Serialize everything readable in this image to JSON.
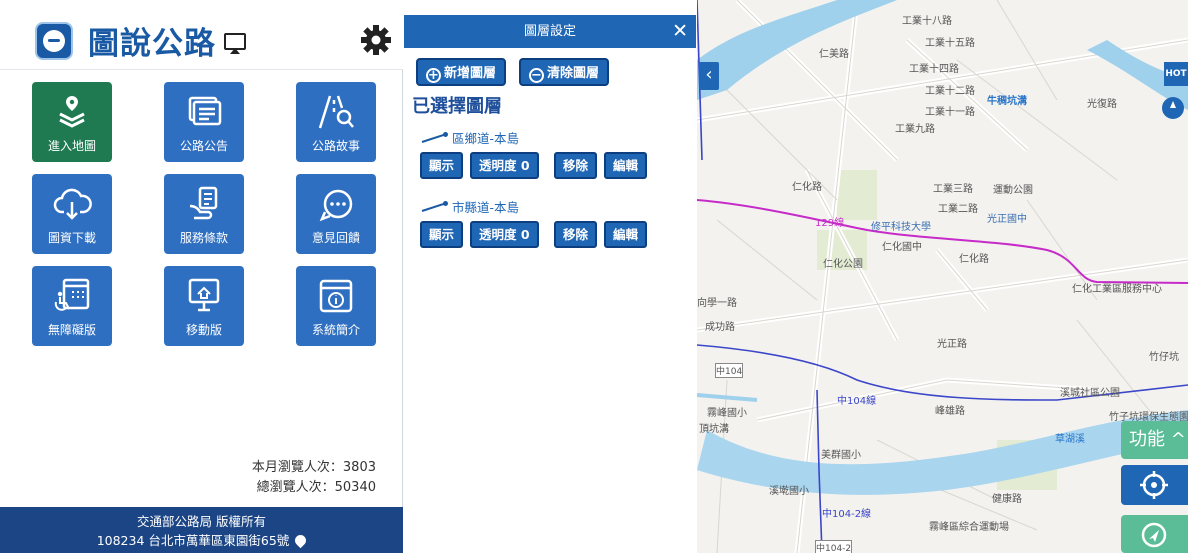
{
  "app": {
    "title": "圖說公路",
    "tiles": [
      {
        "label": "進入地圖",
        "icon": "map-layers-icon"
      },
      {
        "label": "公路公告",
        "icon": "announcement-icon"
      },
      {
        "label": "公路故事",
        "icon": "road-story-icon"
      },
      {
        "label": "圖資下載",
        "icon": "cloud-download-icon"
      },
      {
        "label": "服務條款",
        "icon": "service-terms-icon"
      },
      {
        "label": "意見回饋",
        "icon": "feedback-icon"
      },
      {
        "label": "無障礙版",
        "icon": "accessibility-icon"
      },
      {
        "label": "移動版",
        "icon": "mobile-version-icon"
      },
      {
        "label": "系統簡介",
        "icon": "system-info-icon"
      }
    ],
    "stats": {
      "monthly": "本月瀏覽人次：3803",
      "total": "總瀏覽人次：50340"
    },
    "footer": {
      "line1": "交通部公路局 版權所有",
      "line2": "108234 台北市萬華區東園街65號"
    }
  },
  "layer_panel": {
    "title": "圖層設定",
    "close": "✕",
    "add_label": "新增圖層",
    "clear_label": "清除圖層",
    "subtitle": "已選擇圖層",
    "layers": [
      {
        "name": "區鄉道-本島",
        "show": "顯示",
        "opacity": "透明度 0",
        "remove": "移除",
        "edit": "編輯"
      },
      {
        "name": "市縣道-本島",
        "show": "顯示",
        "opacity": "透明度 0",
        "remove": "移除",
        "edit": "編輯"
      }
    ]
  },
  "map": {
    "back": "‹",
    "hot": "HOT",
    "function_label": "功能 ^",
    "labels": [
      "工業十八路",
      "工業十五路",
      "工業十四路",
      "工業十二路",
      "工業十一路",
      "工業九路",
      "牛稠坑溝",
      "仁化路",
      "129線",
      "修平科技大學",
      "仁化國中",
      "仁化公園",
      "工業三路",
      "工業二路",
      "運動公園",
      "光正國中",
      "仁化路",
      "仁化工業區服務中心",
      "光正路",
      "中104",
      "中104線",
      "霧峰國小",
      "頂坑溝",
      "美群國小",
      "草湖溪",
      "健康路",
      "竹仔坑",
      "竹子坑環保生態園",
      "霧峰區綜合運動場",
      "中104-2",
      "中104-2線",
      "溪城社區公園",
      "仁美路",
      "光復路",
      "向學一路",
      "成功路",
      "溪墘國小",
      "峰雄路"
    ],
    "route_colors": {
      "provincial": "#c62bc9",
      "county": "#3b46c9"
    }
  }
}
